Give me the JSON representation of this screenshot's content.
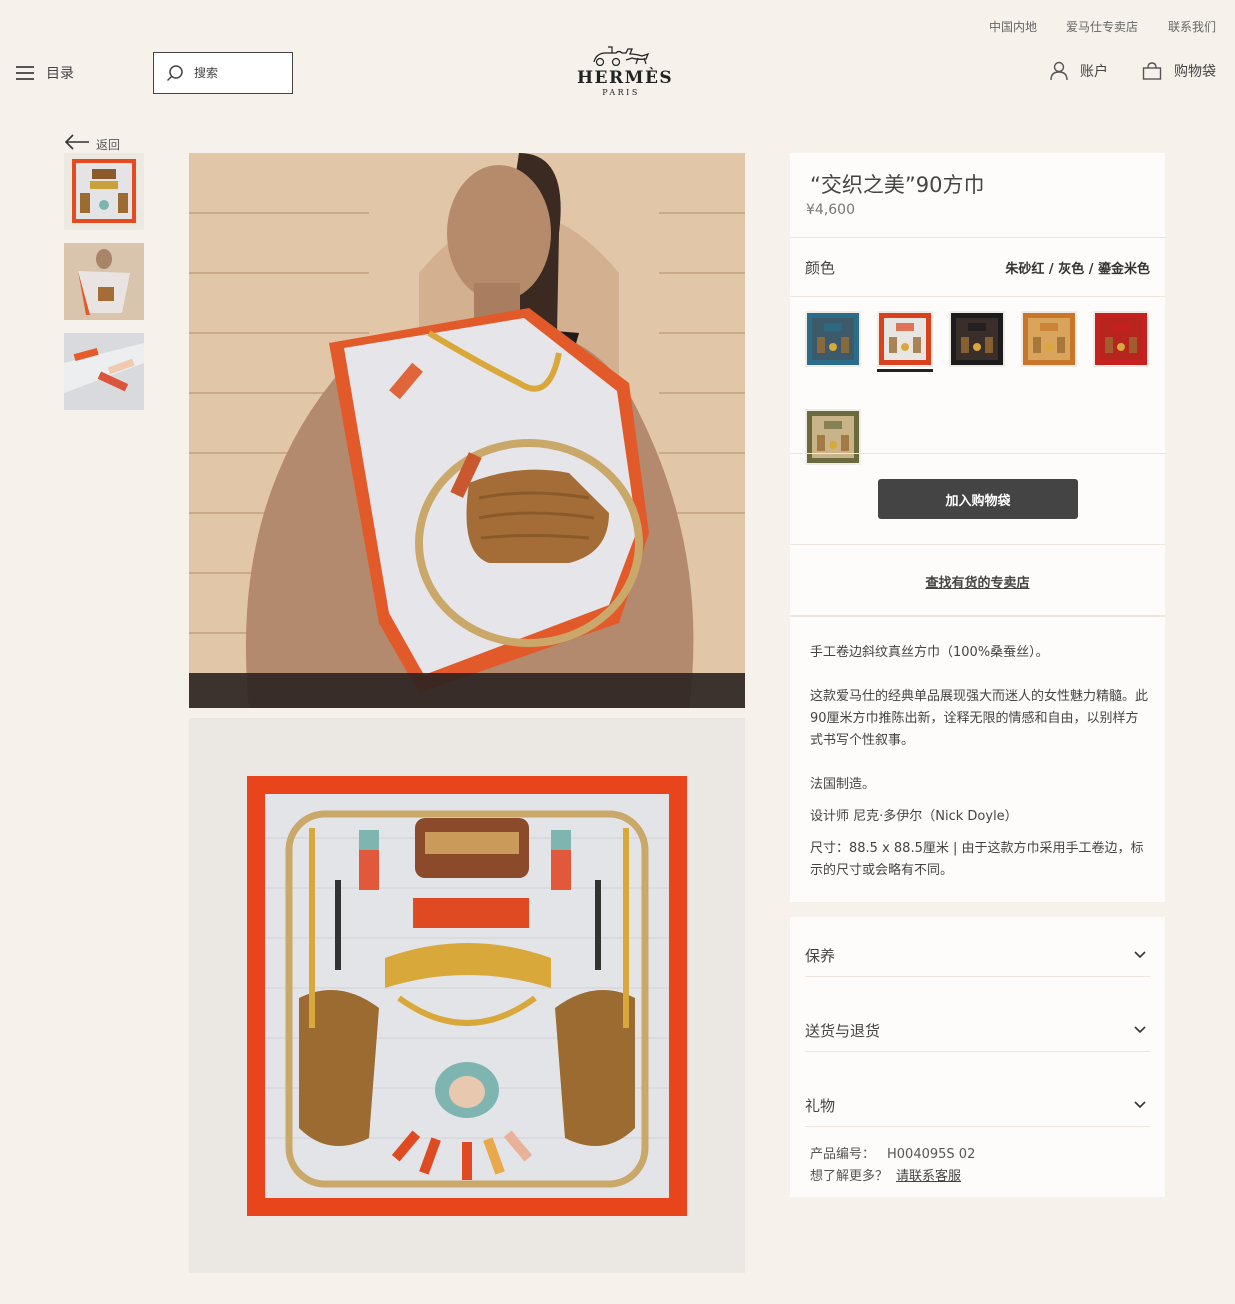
{
  "utility_nav": {
    "region": "中国内地",
    "store": "爱马仕专卖店",
    "contact": "联系我们"
  },
  "header": {
    "menu_label": "目录",
    "search_placeholder": "搜索",
    "logo_name": "HERMÈS",
    "logo_sub": "PARIS",
    "account_label": "账户",
    "bag_label": "购物袋"
  },
  "back_label": "返回",
  "product": {
    "title": "“交织之美”90方巾",
    "price": "¥4,600",
    "color_label": "颜色",
    "color_value": "朱砂红 / 灰色 / 鎏金米色",
    "add_to_bag": "加入购物袋",
    "find_store": "查找有货的专卖店",
    "description": [
      "手工卷边斜纹真丝方巾（100%桑蚕丝）。",
      "这款爱马仕的经典单品展现强大而迷人的女性魅力精髓。此90厘米方巾推陈出新，诠释无限的情感和自由，以别样方式书写个性叙事。",
      "法国制造。",
      "设计师 尼克·多伊尔（Nick Doyle）",
      "尺寸：88.5 x 88.5厘米 | 由于这款方巾采用手工卷边，标示的尺寸或会略有不同。"
    ],
    "accordion": [
      "保养",
      "送货与退货",
      "礼物"
    ],
    "sku_label": "产品编号：",
    "sku": "H004095S 02",
    "help_label": "想了解更多？",
    "help_link": "请联系客服"
  },
  "swatches": [
    {
      "name": "blue",
      "border": "#2b6c8a",
      "fill": "#3d5a6b"
    },
    {
      "name": "cinnabar-grey-gold",
      "border": "#d9421c",
      "fill": "#e8e6e2",
      "selected": true
    },
    {
      "name": "black",
      "border": "#1c1c1c",
      "fill": "#3a2e2a"
    },
    {
      "name": "gold",
      "border": "#c9762a",
      "fill": "#d9a45c"
    },
    {
      "name": "red",
      "border": "#c8201e",
      "fill": "#b8241e"
    },
    {
      "name": "khaki",
      "border": "#6b6a3e",
      "fill": "#c9b48a"
    }
  ]
}
